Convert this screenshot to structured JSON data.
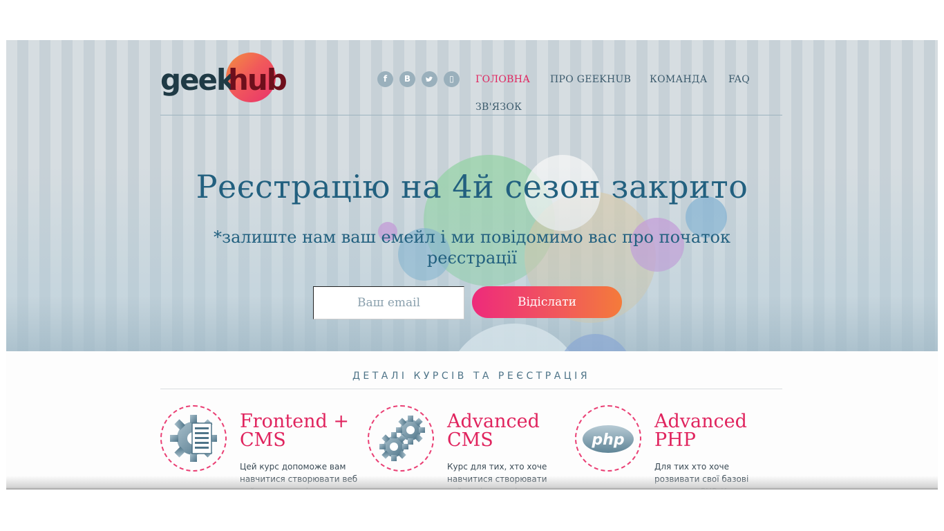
{
  "logo": {
    "geek": "geek",
    "hub": "hub"
  },
  "socials": [
    {
      "name": "facebook",
      "glyph": "f"
    },
    {
      "name": "vkontakte",
      "glyph": "B"
    },
    {
      "name": "twitter",
      "glyph": "t"
    },
    {
      "name": "youtube",
      "glyph": "▯"
    }
  ],
  "nav": {
    "home": "ГОЛОВНА",
    "about": "ПРО GEEKHUB",
    "team": "КОМАНДА",
    "faq": "FAQ",
    "contact": "ЗВ'ЯЗОК"
  },
  "hero": {
    "title": "Реєстрацію на 4й сезон закрито",
    "subtitle": "*залиште нам ваш емейл і ми повідомимо вас про початок реєстрації",
    "email_placeholder": "Ваш email",
    "submit_label": "Відіслати"
  },
  "courses_section": {
    "title": "ДЕТАЛІ КУРСІВ ТА РЕЄСТРАЦІЯ",
    "items": [
      {
        "icon": "gear-document-icon",
        "title": "Frontend + CMS",
        "desc": "Цей курс допоможе вам навчитися створювати веб сайти на основі системи"
      },
      {
        "icon": "gears-icon",
        "title": "Advanced CMS",
        "desc": "Курс для тих, хто хоче навчитися створювати сайти різного рівня складності за"
      },
      {
        "icon": "php-logo-icon",
        "title": "Advanced PHP",
        "desc": "Для тих хто хоче розвивати свої базові навички в PHP. Курс заглиблюється у"
      }
    ]
  },
  "colors": {
    "accent": "#e0245e",
    "nav_text": "#3b5a6c",
    "hero_text": "#22607f",
    "dashed_border": "#ea3f74"
  }
}
